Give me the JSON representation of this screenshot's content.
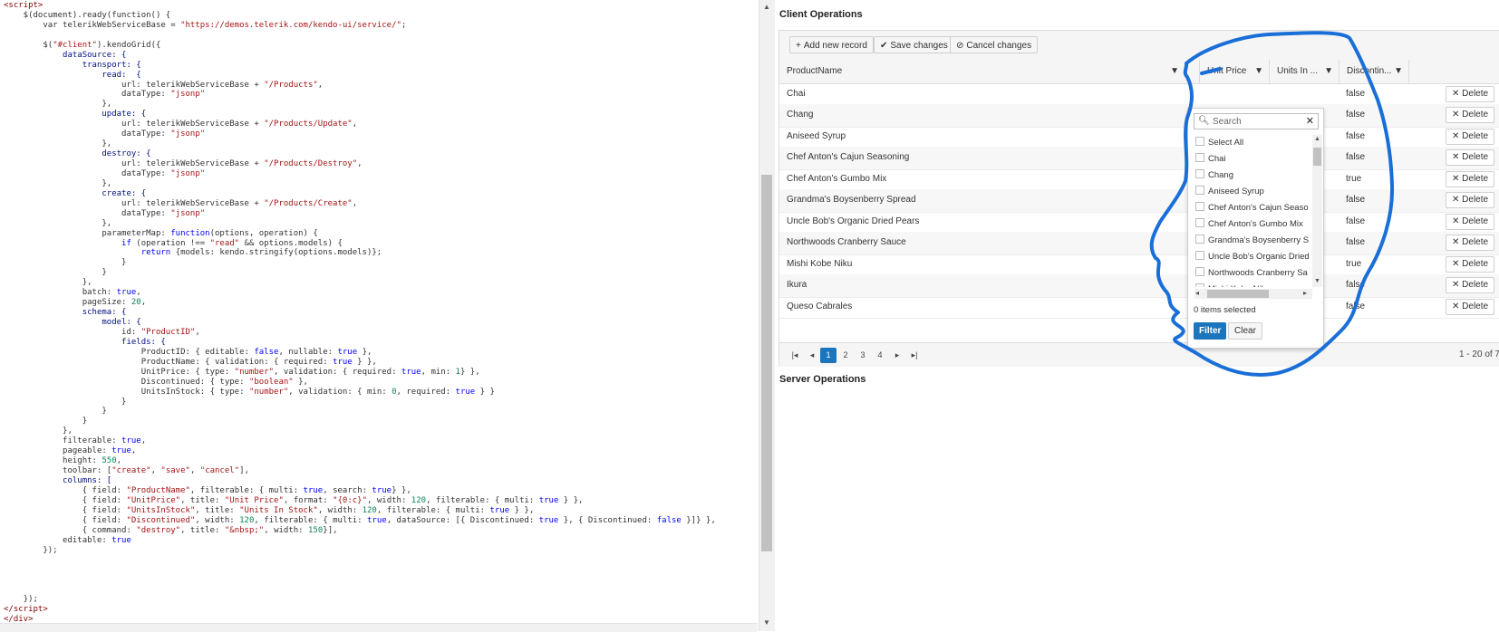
{
  "code": {
    "lines": [
      [
        [
          "<script>",
          "tag"
        ]
      ],
      [
        [
          "    $(document).ready(function() {",
          ""
        ]
      ],
      [
        [
          "        var telerikWebServiceBase = ",
          ""
        ],
        [
          "\"https://demos.telerik.com/kendo-ui/service/\"",
          "str"
        ],
        [
          ";",
          ""
        ]
      ],
      [
        [
          "",
          ""
        ]
      ],
      [
        [
          "        $(",
          ""
        ],
        [
          "\"#client\"",
          "str"
        ],
        [
          ").kendoGrid({",
          ""
        ]
      ],
      [
        [
          "            dataSource: {",
          "prop"
        ]
      ],
      [
        [
          "                transport: {",
          "prop"
        ]
      ],
      [
        [
          "                    read:  {",
          "prop"
        ]
      ],
      [
        [
          "                        url: telerikWebServiceBase + ",
          ""
        ],
        [
          "\"/Products\"",
          "str"
        ],
        [
          ",",
          ""
        ]
      ],
      [
        [
          "                        dataType: ",
          ""
        ],
        [
          "\"jsonp\"",
          "str"
        ]
      ],
      [
        [
          "                    },",
          ""
        ]
      ],
      [
        [
          "                    update: {",
          "prop"
        ]
      ],
      [
        [
          "                        url: telerikWebServiceBase + ",
          ""
        ],
        [
          "\"/Products/Update\"",
          "str"
        ],
        [
          ",",
          ""
        ]
      ],
      [
        [
          "                        dataType: ",
          ""
        ],
        [
          "\"jsonp\"",
          "str"
        ]
      ],
      [
        [
          "                    },",
          ""
        ]
      ],
      [
        [
          "                    destroy: {",
          "prop"
        ]
      ],
      [
        [
          "                        url: telerikWebServiceBase + ",
          ""
        ],
        [
          "\"/Products/Destroy\"",
          "str"
        ],
        [
          ",",
          ""
        ]
      ],
      [
        [
          "                        dataType: ",
          ""
        ],
        [
          "\"jsonp\"",
          "str"
        ]
      ],
      [
        [
          "                    },",
          ""
        ]
      ],
      [
        [
          "                    create: {",
          "prop"
        ]
      ],
      [
        [
          "                        url: telerikWebServiceBase + ",
          ""
        ],
        [
          "\"/Products/Create\"",
          "str"
        ],
        [
          ",",
          ""
        ]
      ],
      [
        [
          "                        dataType: ",
          ""
        ],
        [
          "\"jsonp\"",
          "str"
        ]
      ],
      [
        [
          "                    },",
          ""
        ]
      ],
      [
        [
          "                    parameterMap: ",
          ""
        ],
        [
          "function",
          "kw"
        ],
        [
          "(options, operation) {",
          ""
        ]
      ],
      [
        [
          "                        ",
          ""
        ],
        [
          "if",
          "kw"
        ],
        [
          " (operation !== ",
          ""
        ],
        [
          "\"read\"",
          "str"
        ],
        [
          " && options.models) {",
          ""
        ]
      ],
      [
        [
          "                            ",
          ""
        ],
        [
          "return",
          "kw"
        ],
        [
          " {models: kendo.stringify(options.models)};",
          ""
        ]
      ],
      [
        [
          "                        }",
          ""
        ]
      ],
      [
        [
          "                    }",
          ""
        ]
      ],
      [
        [
          "                },",
          ""
        ]
      ],
      [
        [
          "                batch: ",
          ""
        ],
        [
          "true",
          "kw"
        ],
        [
          ",",
          ""
        ]
      ],
      [
        [
          "                pageSize: ",
          ""
        ],
        [
          "20",
          "num"
        ],
        [
          ",",
          ""
        ]
      ],
      [
        [
          "                schema: {",
          "prop"
        ]
      ],
      [
        [
          "                    model: {",
          "prop"
        ]
      ],
      [
        [
          "                        id: ",
          ""
        ],
        [
          "\"ProductID\"",
          "str"
        ],
        [
          ",",
          ""
        ]
      ],
      [
        [
          "                        fields: {",
          "prop"
        ]
      ],
      [
        [
          "                            ProductID: { editable: ",
          ""
        ],
        [
          "false",
          "kw"
        ],
        [
          ", nullable: ",
          ""
        ],
        [
          "true",
          "kw"
        ],
        [
          " },",
          ""
        ]
      ],
      [
        [
          "                            ProductName: { validation: { required: ",
          ""
        ],
        [
          "true",
          "kw"
        ],
        [
          " } },",
          ""
        ]
      ],
      [
        [
          "                            UnitPrice: { type: ",
          ""
        ],
        [
          "\"number\"",
          "str"
        ],
        [
          ", validation: { required: ",
          ""
        ],
        [
          "true",
          "kw"
        ],
        [
          ", min: ",
          ""
        ],
        [
          "1",
          "num"
        ],
        [
          "} },",
          ""
        ]
      ],
      [
        [
          "                            Discontinued: { type: ",
          ""
        ],
        [
          "\"boolean\"",
          "str"
        ],
        [
          " },",
          ""
        ]
      ],
      [
        [
          "                            UnitsInStock: { type: ",
          ""
        ],
        [
          "\"number\"",
          "str"
        ],
        [
          ", validation: { min: ",
          ""
        ],
        [
          "0",
          "num"
        ],
        [
          ", required: ",
          ""
        ],
        [
          "true",
          "kw"
        ],
        [
          " } }",
          ""
        ]
      ],
      [
        [
          "                        }",
          ""
        ]
      ],
      [
        [
          "                    }",
          ""
        ]
      ],
      [
        [
          "                }",
          ""
        ]
      ],
      [
        [
          "            },",
          ""
        ]
      ],
      [
        [
          "            filterable: ",
          ""
        ],
        [
          "true",
          "kw"
        ],
        [
          ",",
          ""
        ]
      ],
      [
        [
          "            pageable: ",
          ""
        ],
        [
          "true",
          "kw"
        ],
        [
          ",",
          ""
        ]
      ],
      [
        [
          "            height: ",
          ""
        ],
        [
          "550",
          "num"
        ],
        [
          ",",
          ""
        ]
      ],
      [
        [
          "            toolbar: [",
          ""
        ],
        [
          "\"create\"",
          "str"
        ],
        [
          ", ",
          ""
        ],
        [
          "\"save\"",
          "str"
        ],
        [
          ", ",
          ""
        ],
        [
          "\"cancel\"",
          "str"
        ],
        [
          "],",
          ""
        ]
      ],
      [
        [
          "            columns: [",
          "prop"
        ]
      ],
      [
        [
          "                { field: ",
          ""
        ],
        [
          "\"ProductName\"",
          "str"
        ],
        [
          ", filterable: { multi: ",
          ""
        ],
        [
          "true",
          "kw"
        ],
        [
          ", search: ",
          ""
        ],
        [
          "true",
          "kw"
        ],
        [
          "} },",
          ""
        ]
      ],
      [
        [
          "                { field: ",
          ""
        ],
        [
          "\"UnitPrice\"",
          "str"
        ],
        [
          ", title: ",
          ""
        ],
        [
          "\"Unit Price\"",
          "str"
        ],
        [
          ", format: ",
          ""
        ],
        [
          "\"{0:c}\"",
          "str"
        ],
        [
          ", width: ",
          ""
        ],
        [
          "120",
          "num"
        ],
        [
          ", filterable: { multi: ",
          ""
        ],
        [
          "true",
          "kw"
        ],
        [
          " } },",
          ""
        ]
      ],
      [
        [
          "                { field: ",
          ""
        ],
        [
          "\"UnitsInStock\"",
          "str"
        ],
        [
          ", title: ",
          ""
        ],
        [
          "\"Units In Stock\"",
          "str"
        ],
        [
          ", width: ",
          ""
        ],
        [
          "120",
          "num"
        ],
        [
          ", filterable: { multi: ",
          ""
        ],
        [
          "true",
          "kw"
        ],
        [
          " } },",
          ""
        ]
      ],
      [
        [
          "                { field: ",
          ""
        ],
        [
          "\"Discontinued\"",
          "str"
        ],
        [
          ", width: ",
          ""
        ],
        [
          "120",
          "num"
        ],
        [
          ", filterable: { multi: ",
          ""
        ],
        [
          "true",
          "kw"
        ],
        [
          ", dataSource: [{ Discontinued: ",
          ""
        ],
        [
          "true",
          "kw"
        ],
        [
          " }, { Discontinued: ",
          ""
        ],
        [
          "false",
          "kw"
        ],
        [
          " }]} },",
          ""
        ]
      ],
      [
        [
          "                { command: ",
          ""
        ],
        [
          "\"destroy\"",
          "str"
        ],
        [
          ", title: ",
          ""
        ],
        [
          "\"&nbsp;\"",
          "str"
        ],
        [
          ", width: ",
          ""
        ],
        [
          "150",
          "num"
        ],
        [
          "}],",
          ""
        ]
      ],
      [
        [
          "            editable: ",
          ""
        ],
        [
          "true",
          "kw"
        ]
      ],
      [
        [
          "        });",
          ""
        ]
      ],
      [
        [
          "",
          ""
        ]
      ],
      [
        [
          "",
          ""
        ]
      ],
      [
        [
          "",
          ""
        ]
      ],
      [
        [
          "",
          ""
        ]
      ],
      [
        [
          "    });",
          ""
        ]
      ],
      [
        [
          "</",
          "tag"
        ],
        [
          "script",
          "tag"
        ],
        [
          ">",
          "tag"
        ]
      ],
      [
        [
          "</div>",
          "tag"
        ]
      ]
    ]
  },
  "preview": {
    "client_title": "Client Operations",
    "server_title": "Server Operations",
    "toolbar": {
      "add_label": "Add new record",
      "save_label": "Save changes",
      "cancel_label": "Cancel changes"
    },
    "columns": {
      "product_name": "ProductName",
      "unit_price": "Unit Price",
      "units_in": "Units In ...",
      "discontinued": "Discontin..."
    },
    "rows": [
      {
        "name": "Chai",
        "disc": "false"
      },
      {
        "name": "Chang",
        "disc": "false"
      },
      {
        "name": "Aniseed Syrup",
        "disc": "false"
      },
      {
        "name": "Chef Anton's Cajun Seasoning",
        "disc": "false"
      },
      {
        "name": "Chef Anton's Gumbo Mix",
        "disc": "true"
      },
      {
        "name": "Grandma's Boysenberry Spread",
        "disc": "false"
      },
      {
        "name": "Uncle Bob's Organic Dried Pears",
        "disc": "false"
      },
      {
        "name": "Northwoods Cranberry Sauce",
        "disc": "false"
      },
      {
        "name": "Mishi Kobe Niku",
        "disc": "true"
      },
      {
        "name": "Ikura",
        "disc": "false"
      },
      {
        "name": "Queso Cabrales",
        "disc": "false"
      }
    ],
    "delete_label": "Delete",
    "pager": {
      "pages": [
        "1",
        "2",
        "3",
        "4"
      ],
      "active_page": "1",
      "info": "1 - 20 of 7"
    },
    "filter_popup": {
      "search_placeholder": "Search",
      "items": [
        "Select All",
        "Chai",
        "Chang",
        "Aniseed Syrup",
        "Chef Anton's Cajun Seaso",
        "Chef Anton's Gumbo Mix",
        "Grandma's Boysenberry S",
        "Uncle Bob's Organic Dried",
        "Northwoods Cranberry Sa",
        "Mishi Kobe Niku"
      ],
      "count_text": "0 items selected",
      "filter_label": "Filter",
      "clear_label": "Clear"
    },
    "colors": {
      "accent": "#1b76bd",
      "annotation": "#1a6ed8"
    }
  }
}
